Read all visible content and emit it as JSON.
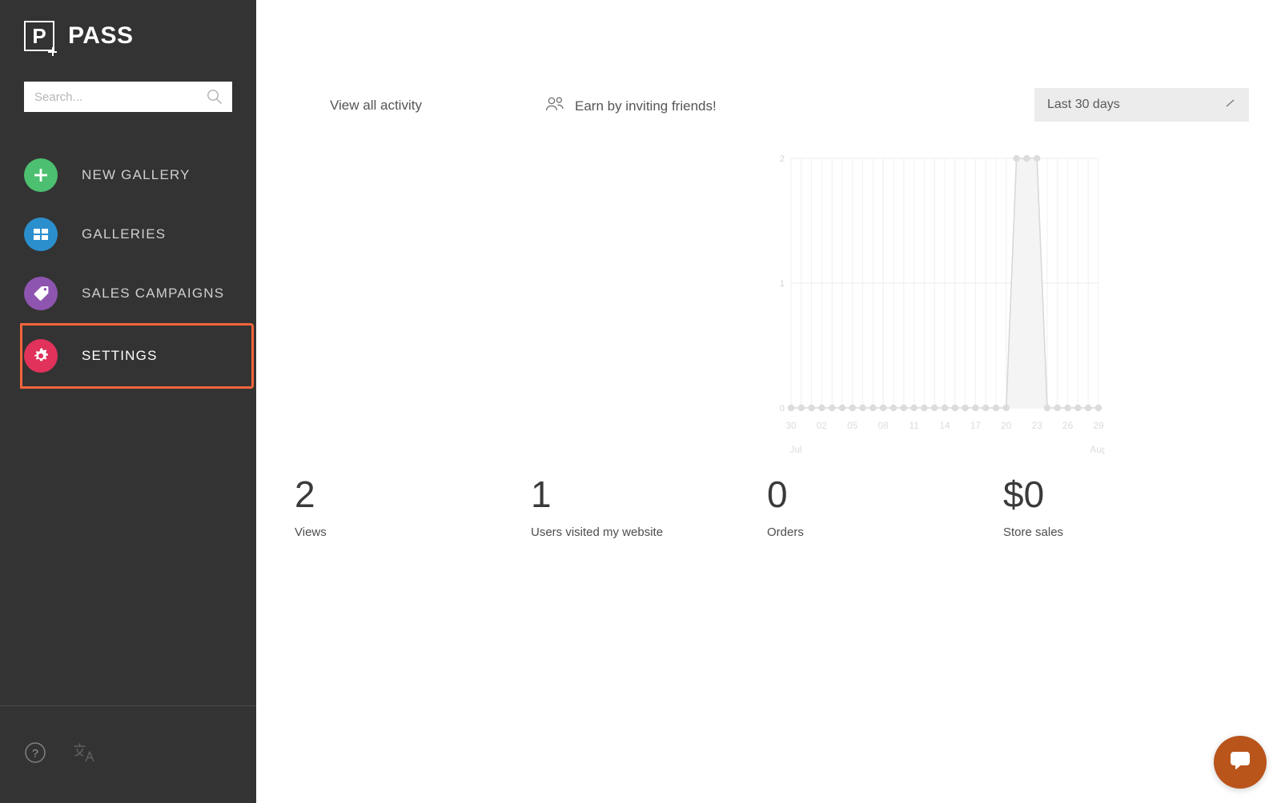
{
  "brand": {
    "logo_letter": "P",
    "name": "PASS"
  },
  "sidebar": {
    "search": {
      "placeholder": "Search...",
      "value": "",
      "icon": "search-icon"
    },
    "items": [
      {
        "label": "NEW GALLERY",
        "icon": "plus-icon",
        "color": "#4cbf70",
        "selected": false
      },
      {
        "label": "GALLERIES",
        "icon": "grid-icon",
        "color": "#2b8fce",
        "selected": false
      },
      {
        "label": "SALES CAMPAIGNS",
        "icon": "tag-icon",
        "color": "#8e55b0",
        "selected": false
      },
      {
        "label": "SETTINGS",
        "icon": "gear-icon",
        "color": "#e0325a",
        "selected": true
      }
    ],
    "selected_outline_color": "#f1643c",
    "footer": [
      {
        "icon": "help-icon"
      },
      {
        "icon": "translate-icon"
      }
    ]
  },
  "header": {
    "view_activity_label": "View all activity",
    "invite_label": "Earn by inviting friends!",
    "invite_icon": "people-icon",
    "date_range": {
      "value": "Last 30 days",
      "caret_icon": "diagonal-caret-icon"
    }
  },
  "stats": [
    {
      "value": "2",
      "label": "Views"
    },
    {
      "value": "1",
      "label": "Users visited my website"
    },
    {
      "value": "0",
      "label": "Orders"
    },
    {
      "value": "$0",
      "label": "Store sales"
    }
  ],
  "chart_data": {
    "type": "line",
    "title": "",
    "xlabel": "",
    "ylabel": "",
    "ylim": [
      0,
      2
    ],
    "yticks": [
      0,
      1,
      2
    ],
    "ytick_labels": [
      "0",
      "1",
      "2"
    ],
    "grid": true,
    "legend": null,
    "month_labels": [
      "Jul",
      "Aug"
    ],
    "xtick_labels": [
      "30",
      "02",
      "05",
      "08",
      "11",
      "14",
      "17",
      "20",
      "23",
      "26",
      "29"
    ],
    "x": [
      "30",
      "31",
      "01",
      "02",
      "03",
      "04",
      "05",
      "06",
      "07",
      "08",
      "09",
      "10",
      "11",
      "12",
      "13",
      "14",
      "15",
      "16",
      "17",
      "18",
      "19",
      "20",
      "21",
      "22",
      "23",
      "24",
      "25",
      "26",
      "27",
      "28",
      "29"
    ],
    "values": [
      0,
      0,
      0,
      0,
      0,
      0,
      0,
      0,
      0,
      0,
      0,
      0,
      0,
      0,
      0,
      0,
      0,
      0,
      0,
      0,
      0,
      0,
      2,
      2,
      2,
      0,
      0,
      0,
      0,
      0,
      0
    ],
    "line_color": "#d8d8d8",
    "fill_color": "#f4f4f4",
    "point_color": "#dcdcdc"
  },
  "chat": {
    "icon": "chat-bubble-icon",
    "color": "#b9541b"
  }
}
